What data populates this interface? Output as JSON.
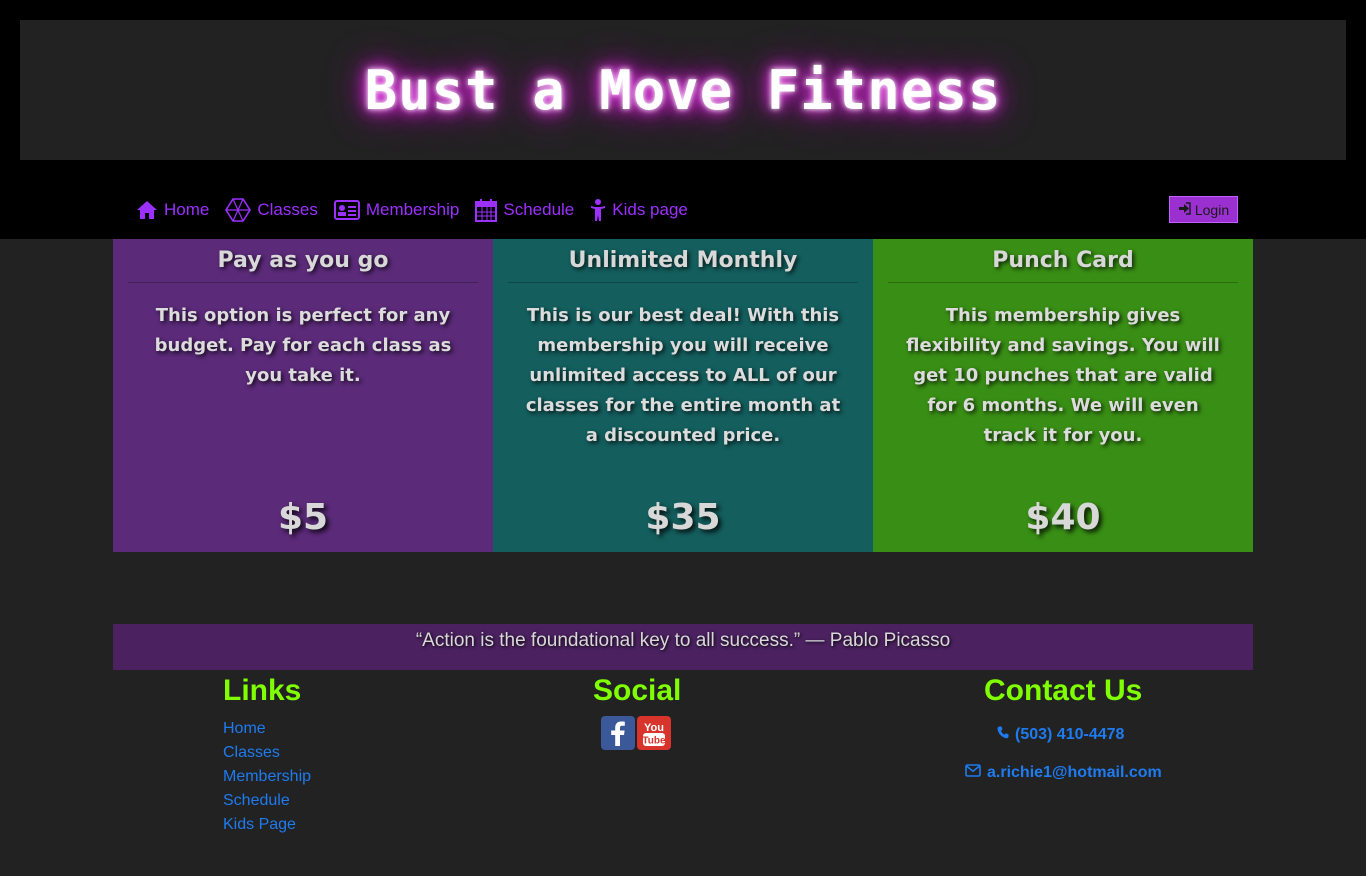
{
  "header": {
    "site_title": "Bust a Move Fitness"
  },
  "nav": {
    "items": [
      {
        "label": "Home",
        "icon": "home-icon"
      },
      {
        "label": "Classes",
        "icon": "classes-icon"
      },
      {
        "label": "Membership",
        "icon": "id-card-icon"
      },
      {
        "label": "Schedule",
        "icon": "calendar-icon"
      },
      {
        "label": "Kids page",
        "icon": "child-icon"
      }
    ],
    "login_label": "Login"
  },
  "membership": {
    "cards": [
      {
        "title": "Pay as you go",
        "description": "This option is perfect for any budget. Pay for each class as you take it.",
        "price": "$5",
        "color": "#5b2a79"
      },
      {
        "title": "Unlimited Monthly",
        "description": "This is our best deal! With this membership you will receive unlimited access to ALL of our classes for the entire month at a discounted price.",
        "price": "$35",
        "color": "#145e5e"
      },
      {
        "title": "Punch Card",
        "description": "This membership gives flexibility and savings. You will get 10 punches that are valid for 6 months. We will even track it for you.",
        "price": "$40",
        "color": "#398f15"
      }
    ]
  },
  "quote": {
    "text": "“Action is the foundational key to all success.” — Pablo Picasso"
  },
  "footer": {
    "links_heading": "Links",
    "links": [
      "Home",
      "Classes",
      "Membership",
      "Schedule",
      "Kids Page"
    ],
    "social_heading": "Social",
    "social_icons": [
      "facebook-icon",
      "youtube-icon"
    ],
    "contact_heading": "Contact Us",
    "phone": "(503) 410-4478",
    "email": "a.richie1@hotmail.com"
  },
  "colors": {
    "accent_purple": "#9b30ff",
    "heading_green": "#7fff00",
    "link_blue": "#1e7bf0"
  }
}
